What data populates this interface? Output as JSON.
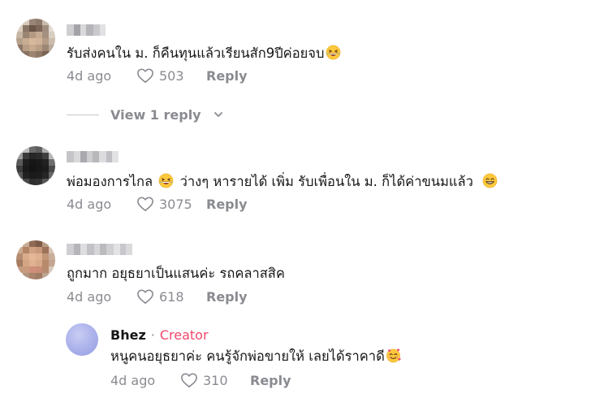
{
  "comments": [
    {
      "text_before": "รับส่งคนใน ม. ก็คืนทุนแล้วเรียนสัก9ปีค่อยจบ",
      "emoji": "grinning-squinting-face",
      "time": "4d ago",
      "likes": "503",
      "reply_label": "Reply"
    },
    {
      "text_part1": "พ่อมองการไกล",
      "text_part2": "ว่างๆ หารายได้ เพิ่ม รับเพื่อนใน ม. ก็ได้ค่าขนมแล้ว",
      "emojis": [
        "grinning-squinting-face",
        "beaming-face"
      ],
      "time": "4d ago",
      "likes": "3075",
      "reply_label": "Reply"
    },
    {
      "text": "ถูกมาก อยุธยาเป็นแสนค่ะ รถคลาสสิค",
      "time": "4d ago",
      "likes": "618",
      "reply_label": "Reply"
    }
  ],
  "view_replies": {
    "label": "View 1 reply"
  },
  "creator_reply": {
    "name": "Bhez",
    "separator": "·",
    "badge": "Creator",
    "text": "หนูคนอยุธยาค่ะ คนรู้จักพ่อขายให้ เลยได้ราคาดี",
    "emoji": "smiling-face-with-hearts",
    "time": "4d ago",
    "likes": "310",
    "reply_label": "Reply"
  },
  "colors": {
    "meta_gray": "#8a8b91",
    "creator_pink": "#f0476a",
    "text": "#161616"
  }
}
